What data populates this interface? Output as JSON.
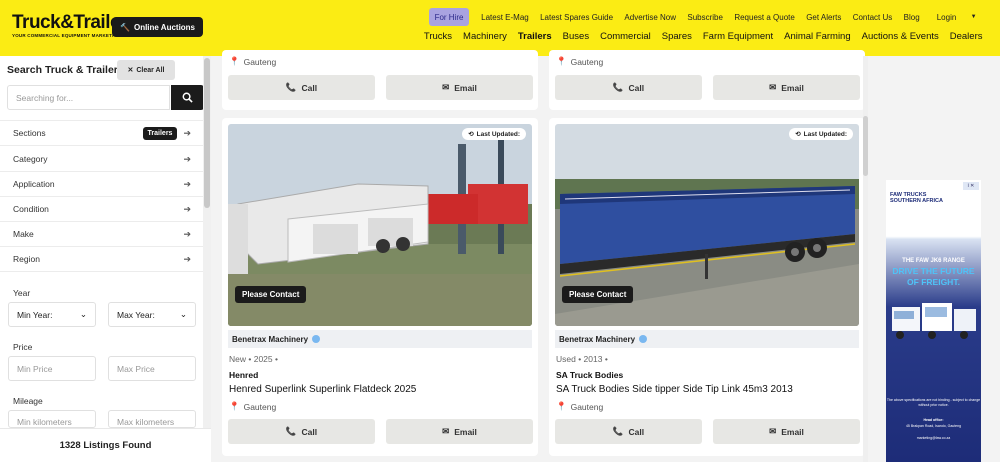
{
  "header": {
    "logo": "Truck&Trailer",
    "tagline": "YOUR COMMERCIAL EQUIPMENT MARKETPLACE",
    "auctions_button": "Online Auctions",
    "top_links": [
      "For Hire",
      "Latest E-Mag",
      "Latest Spares Guide",
      "Advertise Now",
      "Subscribe",
      "Request a Quote",
      "Get Alerts",
      "Contact Us",
      "Blog",
      "Login"
    ],
    "main_links": [
      "Trucks",
      "Machinery",
      "Trailers",
      "Buses",
      "Commercial",
      "Spares",
      "Farm Equipment",
      "Animal Farming",
      "Auctions & Events",
      "Dealers"
    ],
    "active_main": "Trailers"
  },
  "sidebar": {
    "title": "Search Truck & Trailer",
    "clear_label": "Clear All",
    "search_placeholder": "Searching for...",
    "sections_label": "Sections",
    "sections_chip": "Trailers",
    "filters": [
      "Category",
      "Application",
      "Condition",
      "Make",
      "Region"
    ],
    "year_label": "Year",
    "min_year": "Min Year:",
    "max_year": "Max Year:",
    "price_label": "Price",
    "min_price": "Min Price",
    "max_price": "Max Price",
    "mileage_label": "Mileage",
    "min_km": "Min kilometers",
    "max_km": "Max kilometers",
    "listings_found": "1328 Listings Found"
  },
  "listings_top": [
    {
      "location": "Gauteng",
      "call": "Call",
      "email": "Email"
    },
    {
      "location": "Gauteng",
      "call": "Call",
      "email": "Email"
    }
  ],
  "listings": [
    {
      "updated": "Last Updated:",
      "contact": "Please Contact",
      "dealer": "Benetrax Machinery",
      "condition": "New",
      "year": "2025",
      "brand": "Henred",
      "title": "Henred Superlink Superlink Flatdeck 2025",
      "location": "Gauteng",
      "call": "Call",
      "email": "Email"
    },
    {
      "updated": "Last Updated:",
      "contact": "Please Contact",
      "dealer": "Benetrax Machinery",
      "condition": "Used",
      "year": "2013",
      "brand": "SA Truck Bodies",
      "title": "SA Truck Bodies Side tipper Side Tip Link 45m3 2013",
      "location": "Gauteng",
      "call": "Call",
      "email": "Email"
    }
  ],
  "ad": {
    "brand": "FAW TRUCKS SOUTHERN AFRICA",
    "line1": "THE FAW JK6 RANGE",
    "line2": "DRIVE THE FUTURE",
    "line3": "OF FREIGHT.",
    "note": "The above specifications are not binding - subject to change without prior notice.",
    "office": "Head office:",
    "address": "45 Brakpan Road, Isando, Gauteng",
    "email": "marketing@faw.co.za"
  },
  "colors": {
    "brand_yellow": "#fbec14",
    "dark": "#1b1b1b",
    "for_hire": "#a9a3e0"
  }
}
